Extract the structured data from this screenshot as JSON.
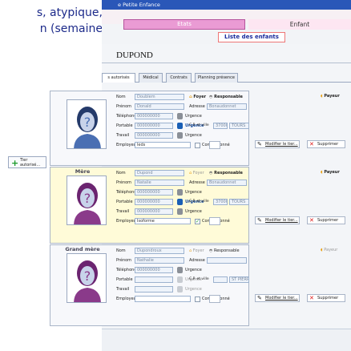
{
  "external_text": {
    "line1": "s, atypique,",
    "line2": "n (semaine"
  },
  "window": {
    "title": "e Petite Enfance"
  },
  "nav": {
    "tab_etats": "Etats",
    "tab_enfant": "Enfant",
    "liste_button": "Liste des enfants"
  },
  "child": {
    "name": "DUPOND"
  },
  "subtabs": [
    "s autorisés",
    "Médical",
    "Contrats",
    "Planning présence"
  ],
  "tiers_button": {
    "line1": "Tier",
    "line2": "autorisé..."
  },
  "field_labels": {
    "nom": "Nom",
    "prenom": "Prénom",
    "telephone": "Téléphone",
    "portable": "Portable",
    "travail": "Travail",
    "employeur": "Employeur",
    "adresse": "Adresse",
    "cp_ville": "C.P. et ville",
    "urgence": "Urgence",
    "foyer": "Foyer",
    "responsable": "Responsable",
    "payeur": "Payeur",
    "conventionne": "Conventionné",
    "modifier": "Modifier le tier...",
    "supprimer": "Supprimer"
  },
  "persons": [
    {
      "role": "",
      "nom": "Doublem",
      "prenom": "Donald",
      "telephone": "000000000",
      "portable": "000000000",
      "travail": "000000000",
      "employeur": "leds",
      "adresse": "Bonaudonnet",
      "cp": "37000",
      "ville": "TOURS",
      "conventionne": false,
      "foyer_active": true,
      "payeur_active": true
    },
    {
      "role": "Mère",
      "nom": "Dupond",
      "prenom": "Natalie",
      "telephone": "000000000",
      "portable": "000000000",
      "travail": "000000000",
      "employeur": "Isoforme",
      "adresse": "Bonaudonnet",
      "cp": "37000",
      "ville": "TOURS",
      "conventionne": true,
      "foyer_active": false,
      "payeur_active": true
    },
    {
      "role": "Grand mère",
      "nom": "Dupondroux",
      "prenom": "Nathalie",
      "telephone": "000000000",
      "portable": "",
      "travail": "",
      "employeur": "",
      "adresse": "",
      "cp": "",
      "ville": "ST PIERRE DE CORPS",
      "conventionne": false,
      "foyer_active": false,
      "payeur_active": false
    }
  ]
}
